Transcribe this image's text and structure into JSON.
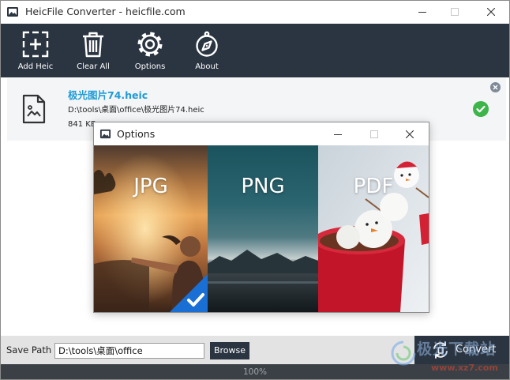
{
  "window": {
    "title": "HeicFile Converter - heicfile.com",
    "app_icon": "app-logo-icon",
    "controls": {
      "minimize": "minimize-icon",
      "maximize": "maximize-icon",
      "close": "close-icon"
    }
  },
  "toolbar": {
    "add_heic": {
      "label": "Add Heic",
      "icon": "add-file-icon"
    },
    "clear_all": {
      "label": "Clear All",
      "icon": "trash-icon"
    },
    "options": {
      "label": "Options",
      "icon": "gear-icon"
    },
    "about": {
      "label": "About",
      "icon": "compass-icon"
    }
  },
  "file_list": [
    {
      "name": "极光图片74.heic",
      "path": "D:\\tools\\桌面\\office\\极光图片74.heic",
      "size": "841 KB",
      "icon": "image-file-icon",
      "status_icon": "check-circle-icon",
      "remove_icon": "remove-circle-icon"
    }
  ],
  "options_dialog": {
    "title": "Options",
    "formats": [
      {
        "label": "JPG",
        "selected": true
      },
      {
        "label": "PNG",
        "selected": false
      },
      {
        "label": "PDF",
        "selected": false
      }
    ],
    "selected_badge_icon": "checkmark-icon"
  },
  "save_path": {
    "label": "Save Path",
    "value": "D:\\tools\\桌面\\office",
    "browse_label": "Browse"
  },
  "convert": {
    "label": "Convert",
    "icon": "convert-icon"
  },
  "progress": {
    "percent": 100,
    "text": "100%"
  },
  "watermark": {
    "name": "极光下载站",
    "url": "www.xz7.com"
  },
  "colors": {
    "toolbar_bg": "#2b3441",
    "accent_blue": "#1e9bd7",
    "success_green": "#3db54a",
    "selected_badge": "#1a6fd4",
    "status_bar_bg": "#3b4046"
  }
}
